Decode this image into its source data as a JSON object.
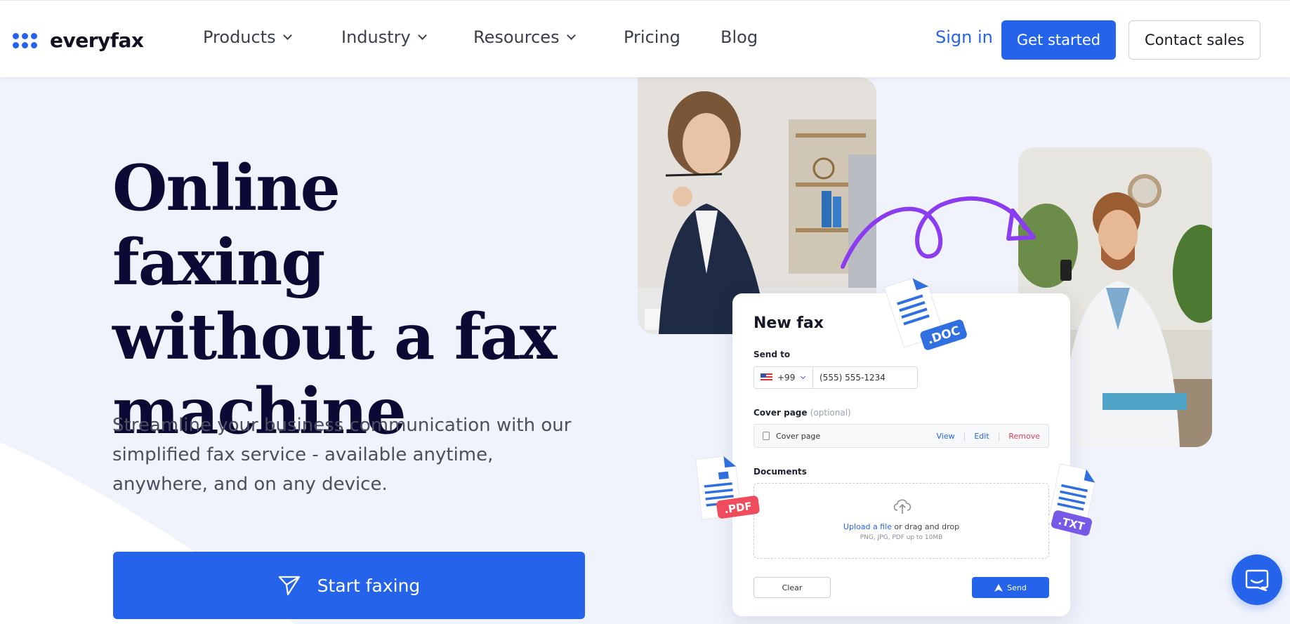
{
  "brand": {
    "name": "everyfax",
    "accent": "#2563eb",
    "headline_color": "#0a0a34"
  },
  "nav": {
    "items": [
      {
        "label": "Products",
        "has_dropdown": true
      },
      {
        "label": "Industry",
        "has_dropdown": true
      },
      {
        "label": "Resources",
        "has_dropdown": true
      },
      {
        "label": "Pricing",
        "has_dropdown": false
      },
      {
        "label": "Blog",
        "has_dropdown": false
      }
    ],
    "sign_in": "Sign in",
    "get_started": "Get started",
    "contact_sales": "Contact sales"
  },
  "hero": {
    "title_line1": "Online faxing",
    "title_line2": "without a fax",
    "title_line3": "machine",
    "subtitle": "Streamline your business communication with our simplified fax service - available anytime, anywhere, and on any device.",
    "cta": "Start faxing"
  },
  "fax_card": {
    "title": "New fax",
    "send_to_label": "Send to",
    "country_code": "+99",
    "phone_value": "(555) 555-1234",
    "cover_label": "Cover page",
    "cover_optional": "(optional)",
    "cover_item": "Cover page",
    "view": "View",
    "edit": "Edit",
    "remove": "Remove",
    "documents_label": "Documents",
    "upload_link": "Upload a file",
    "upload_rest": " or drag and drop",
    "upload_hint": "PNG, JPG, PDF up to 10MB",
    "clear": "Clear",
    "send": "Send"
  },
  "file_badges": {
    "doc": ".DOC",
    "pdf": ".PDF",
    "txt": ".TXT"
  },
  "colors": {
    "doc_badge": "#2f6fe0",
    "pdf_badge": "#ef4d5e",
    "txt_badge": "#7659e6",
    "arrow": "#8b3cf0"
  }
}
